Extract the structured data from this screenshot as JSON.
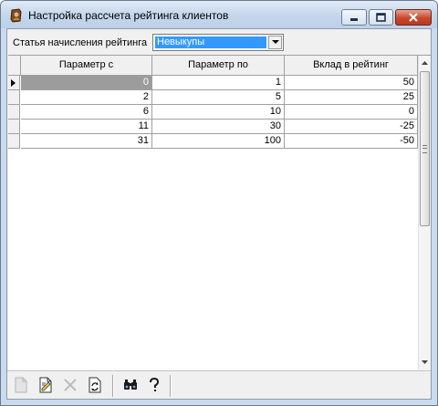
{
  "window": {
    "title": "Настройка рассчета рейтинга клиентов",
    "icon": "app-icon"
  },
  "filter": {
    "label": "Статья начисления рейтинга",
    "selected": "Невыкупы"
  },
  "grid": {
    "columns": [
      "Параметр с",
      "Параметр по",
      "Вклад в рейтинг"
    ],
    "current_row": 0,
    "rows": [
      [
        "0",
        "1",
        "50"
      ],
      [
        "2",
        "5",
        "25"
      ],
      [
        "6",
        "10",
        "0"
      ],
      [
        "11",
        "30",
        "-25"
      ],
      [
        "31",
        "100",
        "-50"
      ]
    ]
  },
  "toolbar": {
    "buttons": [
      {
        "name": "new-record-icon",
        "enabled": false
      },
      {
        "name": "edit-record-icon",
        "enabled": true
      },
      {
        "name": "delete-record-icon",
        "enabled": false
      },
      {
        "name": "refresh-icon",
        "enabled": true
      },
      {
        "name": "find-binoculars-icon",
        "enabled": true
      },
      {
        "name": "help-icon",
        "enabled": true
      }
    ]
  }
}
